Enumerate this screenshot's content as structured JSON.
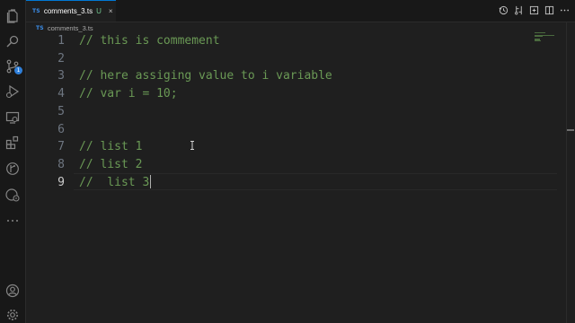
{
  "activity_bar": {
    "icons": [
      "explorer-icon",
      "search-icon",
      "source-control-icon",
      "run-debug-icon",
      "remote-explorer-icon",
      "extensions-icon",
      "git-graph-icon",
      "docker-icon",
      "more-icon",
      "account-icon",
      "settings-gear-icon"
    ],
    "source_control_badge": "1"
  },
  "tab": {
    "file_type_icon": "TS",
    "label": "comments_3.ts",
    "modified_marker": "U",
    "close_glyph": "×"
  },
  "editor_actions": [
    "timeline-icon",
    "compare-changes-icon",
    "open-changes-icon",
    "split-editor-icon",
    "more-actions-icon"
  ],
  "breadcrumb": {
    "file_type_icon": "TS",
    "file": "comments_3.ts"
  },
  "editor": {
    "active_line": 9,
    "lines": [
      {
        "number": "1",
        "text": "// this is commement"
      },
      {
        "number": "2",
        "text": ""
      },
      {
        "number": "3",
        "text": "// here assiging value to i variable"
      },
      {
        "number": "4",
        "text": "// var i = 10;"
      },
      {
        "number": "5",
        "text": ""
      },
      {
        "number": "6",
        "text": ""
      },
      {
        "number": "7",
        "text": "// list 1"
      },
      {
        "number": "8",
        "text": "// list 2"
      },
      {
        "number": "9",
        "text": "//  list 3"
      }
    ]
  },
  "colors": {
    "background": "#1f1f1f",
    "activity_bar": "#181818",
    "comment": "#6a9955",
    "line_number": "#6e7681",
    "active_line_number": "#cccccc",
    "accent": "#0078d4",
    "ts_icon": "#3b8eea",
    "untracked": "#73c991"
  }
}
